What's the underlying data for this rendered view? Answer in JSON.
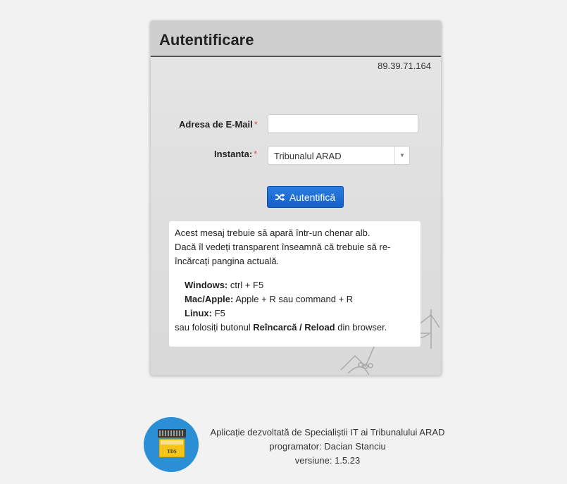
{
  "panel": {
    "title": "Autentificare",
    "ip": "89.39.71.164"
  },
  "form": {
    "email_label": "Adresa de E-Mail",
    "email_value": "",
    "instanta_label": "Instanta:",
    "required_mark": "*",
    "instanta_selected": "Tribunalul ARAD",
    "submit_label": "Autentifică"
  },
  "message": {
    "line1": "Acest mesaj trebuie să apară într-un chenar alb.",
    "line2": "Dacă îl vedeți transparent înseamnă că trebuie să re-încărcați pangina actuală.",
    "keys": [
      {
        "os": "Windows:",
        "combo": "ctrl + F5"
      },
      {
        "os": "Mac/Apple:",
        "combo": "Apple + R sau command + R"
      },
      {
        "os": "Linux:",
        "combo": "F5"
      }
    ],
    "footer_pre": "sau folosiți butonul ",
    "footer_bold": "Reîncarcă / Reload",
    "footer_post": " din browser."
  },
  "footer": {
    "line1": "Aplicație dezvoltată de Specialiștii IT ai Tribunalului ARAD",
    "line2": "programator: Dacian Stanciu",
    "line3": "versiune: 1.5.23",
    "logo_text": "TDS"
  },
  "colors": {
    "accent": "#1a6bd6",
    "required": "#d9534f",
    "logo_circle": "#2b8fd6",
    "logo_card": "#f5c518"
  },
  "icons": {
    "submit": "shuffle-icon",
    "select_arrow": "chevron-down-icon",
    "watermark": "scales-of-justice-icon",
    "logo": "tds-logo"
  }
}
